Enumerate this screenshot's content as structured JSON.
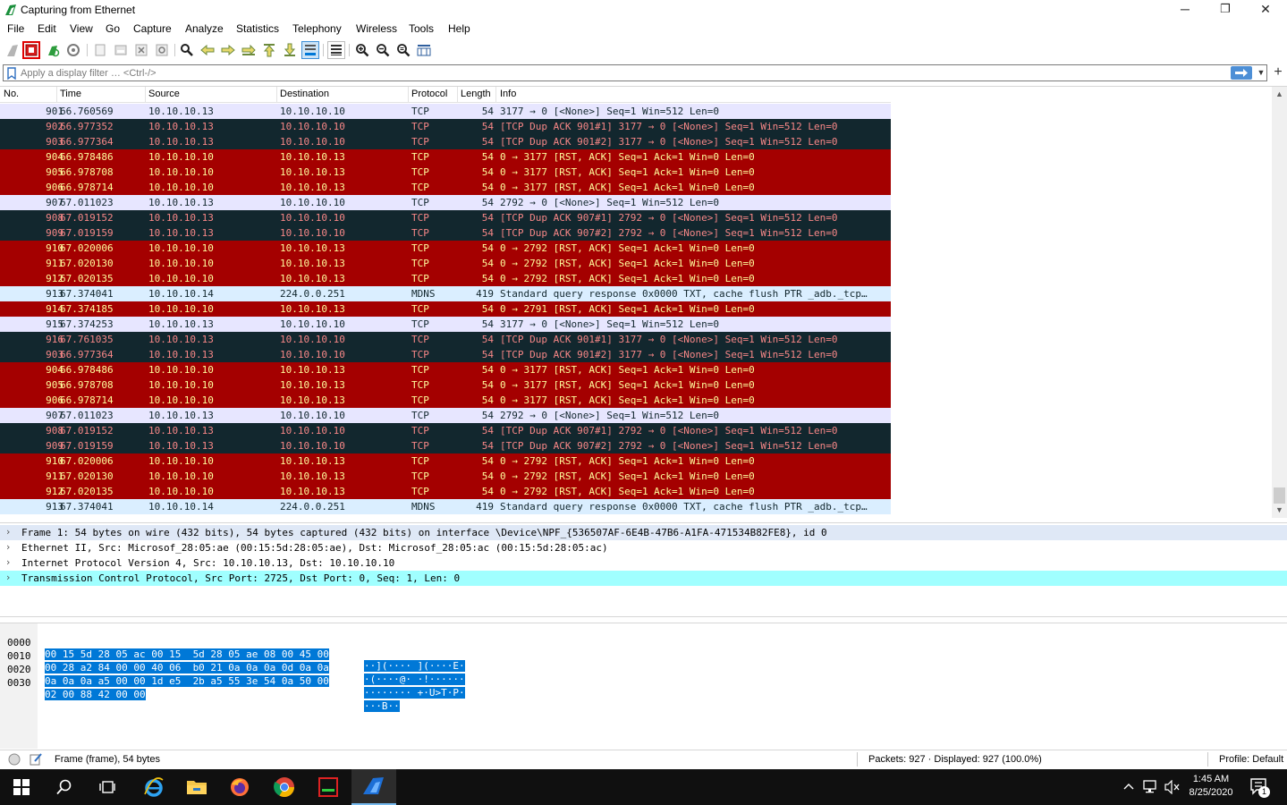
{
  "window": {
    "title": "Capturing from Ethernet",
    "minimize_glyph": "─",
    "restore_glyph": "❐",
    "close_glyph": "✕"
  },
  "menu": [
    "File",
    "Edit",
    "View",
    "Go",
    "Capture",
    "Analyze",
    "Statistics",
    "Telephony",
    "Wireless",
    "Tools",
    "Help"
  ],
  "filter": {
    "placeholder": "Apply a display filter … <Ctrl-/>",
    "value": "",
    "plus_glyph": "+"
  },
  "packet_list": {
    "columns": [
      "No.",
      "Time",
      "Source",
      "Destination",
      "Protocol",
      "Length",
      "Info"
    ],
    "rows": [
      {
        "no": "901",
        "time": "66.760569",
        "src": "10.10.10.13",
        "dst": "10.10.10.10",
        "proto": "TCP",
        "len": "54",
        "info": "3177 → 0 [<None>] Seq=1 Win=512 Len=0",
        "style": "normal"
      },
      {
        "no": "902",
        "time": "66.977352",
        "src": "10.10.10.13",
        "dst": "10.10.10.10",
        "proto": "TCP",
        "len": "54",
        "info": "[TCP Dup ACK 901#1] 3177 → 0 [<None>] Seq=1 Win=512 Len=0",
        "style": "dark"
      },
      {
        "no": "903",
        "time": "66.977364",
        "src": "10.10.10.13",
        "dst": "10.10.10.10",
        "proto": "TCP",
        "len": "54",
        "info": "[TCP Dup ACK 901#2] 3177 → 0 [<None>] Seq=1 Win=512 Len=0",
        "style": "dark"
      },
      {
        "no": "904",
        "time": "66.978486",
        "src": "10.10.10.10",
        "dst": "10.10.10.13",
        "proto": "TCP",
        "len": "54",
        "info": "0 → 3177 [RST, ACK] Seq=1 Ack=1 Win=0 Len=0",
        "style": "red"
      },
      {
        "no": "905",
        "time": "66.978708",
        "src": "10.10.10.10",
        "dst": "10.10.10.13",
        "proto": "TCP",
        "len": "54",
        "info": "0 → 3177 [RST, ACK] Seq=1 Ack=1 Win=0 Len=0",
        "style": "red"
      },
      {
        "no": "906",
        "time": "66.978714",
        "src": "10.10.10.10",
        "dst": "10.10.10.13",
        "proto": "TCP",
        "len": "54",
        "info": "0 → 3177 [RST, ACK] Seq=1 Ack=1 Win=0 Len=0",
        "style": "red"
      },
      {
        "no": "907",
        "time": "67.011023",
        "src": "10.10.10.13",
        "dst": "10.10.10.10",
        "proto": "TCP",
        "len": "54",
        "info": "2792 → 0 [<None>] Seq=1 Win=512 Len=0",
        "style": "normal"
      },
      {
        "no": "908",
        "time": "67.019152",
        "src": "10.10.10.13",
        "dst": "10.10.10.10",
        "proto": "TCP",
        "len": "54",
        "info": "[TCP Dup ACK 907#1] 2792 → 0 [<None>] Seq=1 Win=512 Len=0",
        "style": "dark"
      },
      {
        "no": "909",
        "time": "67.019159",
        "src": "10.10.10.13",
        "dst": "10.10.10.10",
        "proto": "TCP",
        "len": "54",
        "info": "[TCP Dup ACK 907#2] 2792 → 0 [<None>] Seq=1 Win=512 Len=0",
        "style": "dark"
      },
      {
        "no": "910",
        "time": "67.020006",
        "src": "10.10.10.10",
        "dst": "10.10.10.13",
        "proto": "TCP",
        "len": "54",
        "info": "0 → 2792 [RST, ACK] Seq=1 Ack=1 Win=0 Len=0",
        "style": "red"
      },
      {
        "no": "911",
        "time": "67.020130",
        "src": "10.10.10.10",
        "dst": "10.10.10.13",
        "proto": "TCP",
        "len": "54",
        "info": "0 → 2792 [RST, ACK] Seq=1 Ack=1 Win=0 Len=0",
        "style": "red"
      },
      {
        "no": "912",
        "time": "67.020135",
        "src": "10.10.10.10",
        "dst": "10.10.10.13",
        "proto": "TCP",
        "len": "54",
        "info": "0 → 2792 [RST, ACK] Seq=1 Ack=1 Win=0 Len=0",
        "style": "red"
      },
      {
        "no": "913",
        "time": "67.374041",
        "src": "10.10.10.14",
        "dst": "224.0.0.251",
        "proto": "MDNS",
        "len": "419",
        "info": "Standard query response 0x0000 TXT, cache flush PTR _adb._tcp…",
        "style": "mdns"
      },
      {
        "no": "914",
        "time": "67.374185",
        "src": "10.10.10.10",
        "dst": "10.10.10.13",
        "proto": "TCP",
        "len": "54",
        "info": "0 → 2791 [RST, ACK] Seq=1 Ack=1 Win=0 Len=0",
        "style": "red"
      },
      {
        "no": "915",
        "time": "67.374253",
        "src": "10.10.10.13",
        "dst": "10.10.10.10",
        "proto": "TCP",
        "len": "54",
        "info": "3177 → 0 [<None>] Seq=1 Win=512 Len=0",
        "style": "normal"
      },
      {
        "no": "916",
        "time": "67.761035",
        "src": "10.10.10.13",
        "dst": "10.10.10.10",
        "proto": "TCP",
        "len": "54",
        "info": "[TCP Dup ACK 901#1] 3177 → 0 [<None>] Seq=1 Win=512 Len=0",
        "style": "dark"
      },
      {
        "no": "903",
        "time": "66.977364",
        "src": "10.10.10.13",
        "dst": "10.10.10.10",
        "proto": "TCP",
        "len": "54",
        "info": "[TCP Dup ACK 901#2] 3177 → 0 [<None>] Seq=1 Win=512 Len=0",
        "style": "dark"
      },
      {
        "no": "904",
        "time": "66.978486",
        "src": "10.10.10.10",
        "dst": "10.10.10.13",
        "proto": "TCP",
        "len": "54",
        "info": "0 → 3177 [RST, ACK] Seq=1 Ack=1 Win=0 Len=0",
        "style": "red"
      },
      {
        "no": "905",
        "time": "66.978708",
        "src": "10.10.10.10",
        "dst": "10.10.10.13",
        "proto": "TCP",
        "len": "54",
        "info": "0 → 3177 [RST, ACK] Seq=1 Ack=1 Win=0 Len=0",
        "style": "red"
      },
      {
        "no": "906",
        "time": "66.978714",
        "src": "10.10.10.10",
        "dst": "10.10.10.13",
        "proto": "TCP",
        "len": "54",
        "info": "0 → 3177 [RST, ACK] Seq=1 Ack=1 Win=0 Len=0",
        "style": "red"
      },
      {
        "no": "907",
        "time": "67.011023",
        "src": "10.10.10.13",
        "dst": "10.10.10.10",
        "proto": "TCP",
        "len": "54",
        "info": "2792 → 0 [<None>] Seq=1 Win=512 Len=0",
        "style": "normal"
      },
      {
        "no": "908",
        "time": "67.019152",
        "src": "10.10.10.13",
        "dst": "10.10.10.10",
        "proto": "TCP",
        "len": "54",
        "info": "[TCP Dup ACK 907#1] 2792 → 0 [<None>] Seq=1 Win=512 Len=0",
        "style": "dark"
      },
      {
        "no": "909",
        "time": "67.019159",
        "src": "10.10.10.13",
        "dst": "10.10.10.10",
        "proto": "TCP",
        "len": "54",
        "info": "[TCP Dup ACK 907#2] 2792 → 0 [<None>] Seq=1 Win=512 Len=0",
        "style": "dark"
      },
      {
        "no": "910",
        "time": "67.020006",
        "src": "10.10.10.10",
        "dst": "10.10.10.13",
        "proto": "TCP",
        "len": "54",
        "info": "0 → 2792 [RST, ACK] Seq=1 Ack=1 Win=0 Len=0",
        "style": "red"
      },
      {
        "no": "911",
        "time": "67.020130",
        "src": "10.10.10.10",
        "dst": "10.10.10.13",
        "proto": "TCP",
        "len": "54",
        "info": "0 → 2792 [RST, ACK] Seq=1 Ack=1 Win=0 Len=0",
        "style": "red"
      },
      {
        "no": "912",
        "time": "67.020135",
        "src": "10.10.10.10",
        "dst": "10.10.10.13",
        "proto": "TCP",
        "len": "54",
        "info": "0 → 2792 [RST, ACK] Seq=1 Ack=1 Win=0 Len=0",
        "style": "red"
      },
      {
        "no": "913",
        "time": "67.374041",
        "src": "10.10.10.14",
        "dst": "224.0.0.251",
        "proto": "MDNS",
        "len": "419",
        "info": "Standard query response 0x0000 TXT, cache flush PTR _adb._tcp…",
        "style": "mdns"
      }
    ]
  },
  "details": [
    {
      "text": "Frame 1: 54 bytes on wire (432 bits), 54 bytes captured (432 bits) on interface \\Device\\NPF_{536507AF-6E4B-47B6-A1FA-471534B82FE8}, id 0",
      "bg": "#dfe8f6"
    },
    {
      "text": "Ethernet II, Src: Microsof_28:05:ae (00:15:5d:28:05:ae), Dst: Microsof_28:05:ac (00:15:5d:28:05:ac)",
      "bg": "#ffffff"
    },
    {
      "text": "Internet Protocol Version 4, Src: 10.10.10.13, Dst: 10.10.10.10",
      "bg": "#ffffff"
    },
    {
      "text": "Transmission Control Protocol, Src Port: 2725, Dst Port: 0, Seq: 1, Len: 0",
      "bg": "#a0ffff"
    }
  ],
  "bytes": [
    {
      "offset": "0000",
      "hex": "00 15 5d 28 05 ac 00 15  5d 28 05 ae 08 00 45 00",
      "ascii": "··](···· ](····E·"
    },
    {
      "offset": "0010",
      "hex": "00 28 a2 84 00 00 40 06  b0 21 0a 0a 0a 0d 0a 0a",
      "ascii": "·(····@· ·!······"
    },
    {
      "offset": "0020",
      "hex": "0a 0a 0a a5 00 00 1d e5  2b a5 55 3e 54 0a 50 00",
      "ascii": "········ +·U>T·P·"
    },
    {
      "offset": "0030",
      "hex": "02 00 88 42 00 00",
      "ascii": "···B··"
    }
  ],
  "status": {
    "left": "Frame (frame), 54 bytes",
    "packets": "Packets: 927 · Displayed: 927 (100.0%)",
    "profile": "Profile: Default"
  },
  "taskbar": {
    "time": "1:45 AM",
    "date": "8/25/2020",
    "notification_count": "1"
  },
  "colors": {
    "normal_bg": "#e7e6ff",
    "dark_bg": "#12272e",
    "red_bg": "#a40000",
    "mdns_bg": "#daeeff",
    "accent": "#0078d7"
  },
  "icons": [
    "wireshark-fin-icon",
    "start-capture-icon",
    "stop-capture-icon",
    "restart-capture-icon",
    "capture-options-icon",
    "open-file-icon",
    "save-file-icon",
    "close-file-icon",
    "reload-icon",
    "find-icon",
    "back-icon",
    "forward-icon",
    "go-to-packet-icon",
    "first-packet-icon",
    "last-packet-icon",
    "autoscroll-icon",
    "colorize-icon",
    "zoom-in-icon",
    "zoom-out-icon",
    "zoom-reset-icon",
    "resize-columns-icon",
    "bookmark-icon",
    "apply-filter-arrow-icon",
    "dropdown-icon",
    "add-filter-icon"
  ]
}
